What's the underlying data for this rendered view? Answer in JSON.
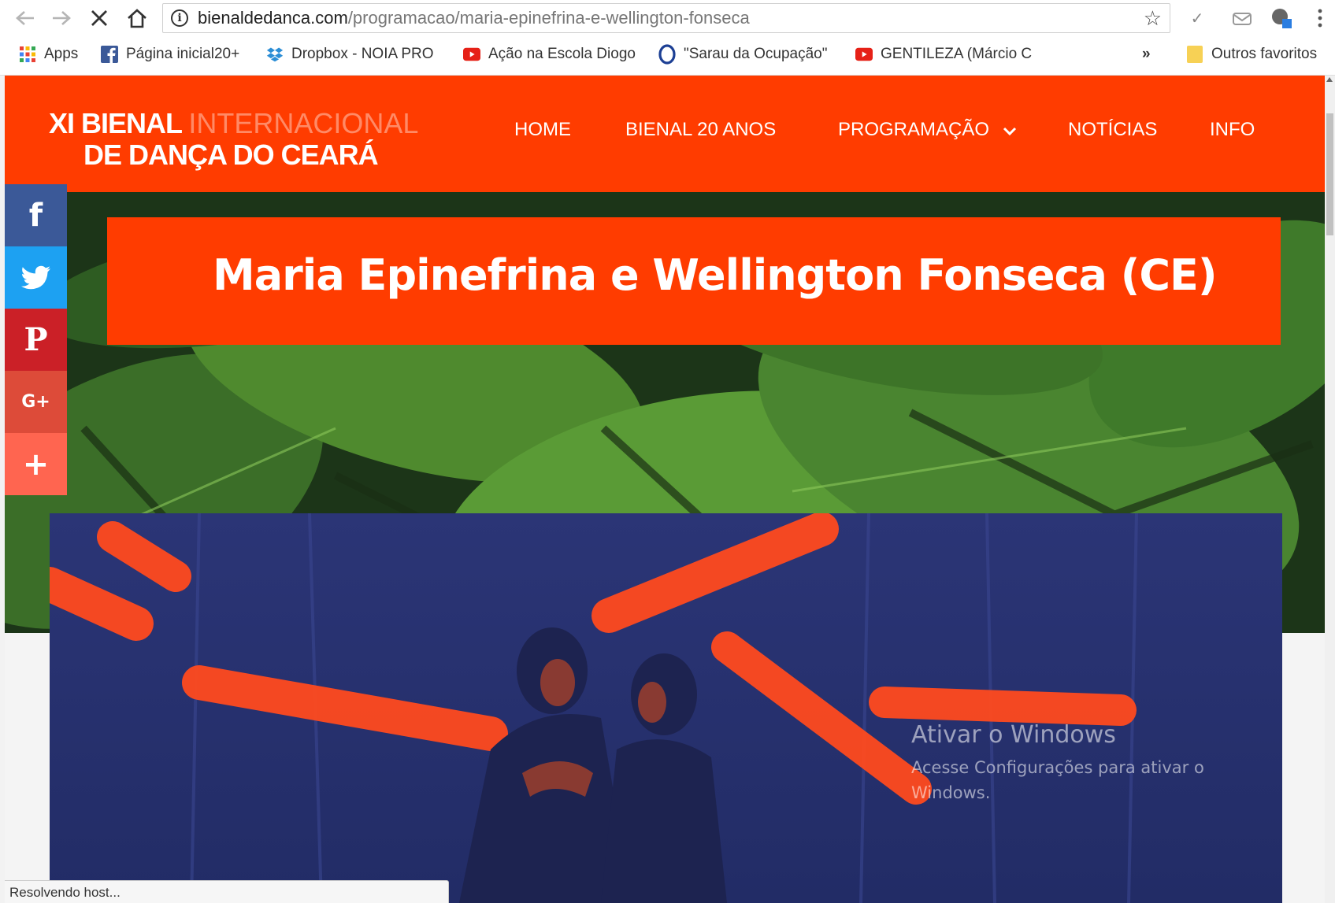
{
  "browser": {
    "url_host": "bienaldedanca.com",
    "url_path": "/programacao/maria-epinefrina-e-wellington-fonseca",
    "bookmarks": [
      {
        "label": "Apps",
        "icon": "apps-grid-icon"
      },
      {
        "label": "Página inicial20+",
        "icon": "facebook-icon"
      },
      {
        "label": "Dropbox - NOIA PRO",
        "icon": "dropbox-icon"
      },
      {
        "label": "Ação na Escola Diogo",
        "icon": "youtube-icon"
      },
      {
        "label": "\"Sarau da Ocupação\"",
        "icon": "opera-icon"
      },
      {
        "label": "GENTILEZA (Márcio C",
        "icon": "youtube-icon"
      }
    ],
    "bookmarks_more": "»",
    "other_bookmarks": "Outros favoritos",
    "status_text": "Resolvendo host..."
  },
  "site": {
    "logo": {
      "bold1": "XI BIENAL",
      "thin1": "INTERNACIONAL",
      "line2": "DE DANÇA DO CEARÁ"
    },
    "menu": [
      "HOME",
      "BIENAL 20 ANOS",
      "PROGRAMAÇÃO",
      "NOTÍCIAS",
      "INFO"
    ],
    "title": "Maria Epinefrina e Wellington Fonseca (CE)",
    "social": [
      {
        "icon": "facebook-icon",
        "glyph": "f",
        "color": "#3b5998"
      },
      {
        "icon": "twitter-icon",
        "glyph": "",
        "color": "#1da1f2"
      },
      {
        "icon": "pinterest-icon",
        "glyph": "P",
        "color": "#cb2027"
      },
      {
        "icon": "google-plus-icon",
        "glyph": "G+",
        "color": "#dd4b39"
      },
      {
        "icon": "share-plus-icon",
        "glyph": "+",
        "color": "#ff6550"
      }
    ],
    "accent": "#ff3c00"
  },
  "watermark": {
    "line1": "Ativar o Windows",
    "line2": "Acesse Configurações para ativar o",
    "line3": "Windows."
  }
}
